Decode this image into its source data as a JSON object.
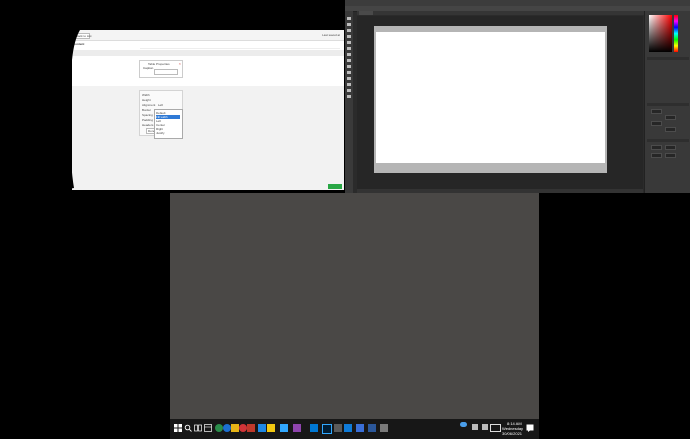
{
  "web_editor": {
    "back_label": "Back to List",
    "last_saved": "Last saved at",
    "content_label": "Content",
    "dialog": {
      "title": "Table Properties",
      "close": "×",
      "sub_label": "Caption"
    },
    "properties": {
      "rows": [
        {
          "label": "Width",
          "value": ""
        },
        {
          "label": "Height",
          "value": ""
        },
        {
          "label": "Alignment",
          "value": "Left"
        },
        {
          "label": "Border",
          "value": ""
        },
        {
          "label": "Spacing",
          "value": ""
        },
        {
          "label": "Padding",
          "value": ""
        },
        {
          "label": "Headers",
          "value": ""
        }
      ],
      "done_label": "Done"
    },
    "dropdown_items": [
      "Default",
      "Fill width",
      "Left",
      "Center",
      "Right",
      "Justify"
    ],
    "dropdown_selected_index": 1
  },
  "photoshop": {
    "tab_label": "Untitled"
  },
  "taskbar": {
    "time": "8:14 AM",
    "day": "Wednesday",
    "date": "30/06/2021"
  },
  "colors": {
    "desktop": "#4a4846",
    "photoshop_bg": "#2b2b2b",
    "taskbar": "#171717"
  }
}
